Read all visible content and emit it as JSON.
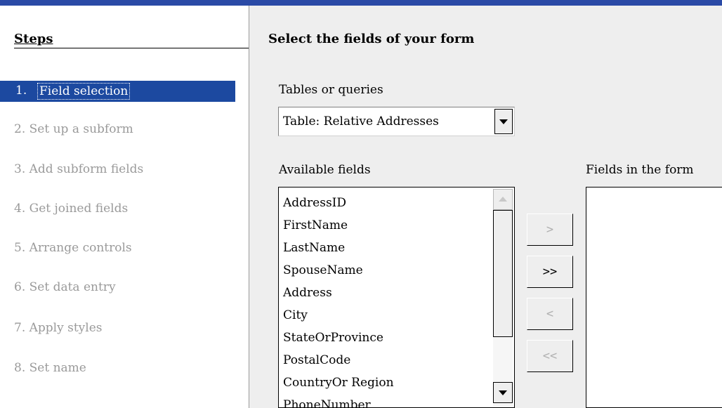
{
  "steps": {
    "title": "Steps",
    "items": [
      {
        "num": "1.",
        "label": "Field selection",
        "active": true
      },
      {
        "num": "2.",
        "label": "Set up a subform"
      },
      {
        "num": "3.",
        "label": "Add subform fields"
      },
      {
        "num": "4.",
        "label": "Get joined fields"
      },
      {
        "num": "5.",
        "label": "Arrange controls"
      },
      {
        "num": "6.",
        "label": "Set data entry"
      },
      {
        "num": "7.",
        "label": "Apply styles"
      },
      {
        "num": "8.",
        "label": "Set name"
      }
    ]
  },
  "main": {
    "heading": "Select the fields of your form",
    "tables_label": "Tables or queries",
    "tables_value": "Table: Relative Addresses",
    "available_label": "Available fields",
    "available_items": [
      "AddressID",
      "FirstName",
      "LastName",
      "SpouseName",
      "Address",
      "City",
      "StateOrProvince",
      "PostalCode",
      "CountryOr Region",
      "PhoneNumber"
    ],
    "infrm_label": "Fields in the form",
    "buttons": {
      "add_one": ">",
      "add_all": ">>",
      "remove_one": "<",
      "remove_all": "<<"
    }
  },
  "colors": {
    "accent": "#1c49a0",
    "topbar": "#2a4aa6",
    "panel": "#eeeeee",
    "disabled_text": "#9a9a9a"
  }
}
